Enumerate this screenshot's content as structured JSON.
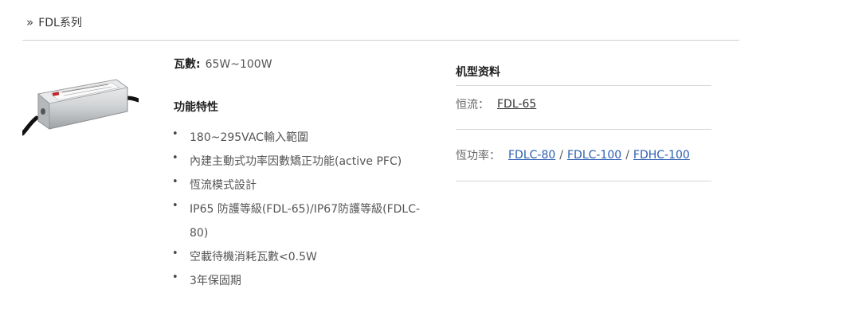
{
  "breadcrumb": {
    "chevron": "»",
    "title": "FDL系列"
  },
  "product": {
    "image_alt": "MEAN WELL FDL LED driver"
  },
  "specs": {
    "watts_label": "瓦數:",
    "watts_value": "65W~100W",
    "features_title": "功能特性",
    "features": [
      "180~295VAC輸入範圍",
      "內建主動式功率因數矯正功能(active PFC)",
      "恆流模式設計",
      "IP65 防護等級(FDL-65)/IP67防護等級(FDLC-80)",
      "空載待機消耗瓦數<0.5W",
      "3年保固期"
    ]
  },
  "models": {
    "title": "机型资料",
    "constant_current_label": "恒流：",
    "constant_current_links": [
      "FDL-65"
    ],
    "constant_power_label": "恆功率：",
    "constant_power_links": [
      "FDLC-80",
      "FDLC-100",
      "FDHC-100"
    ],
    "separator": "/"
  },
  "colors": {
    "link_blue": "#2a5db0",
    "divider": "#cfcfcf"
  }
}
